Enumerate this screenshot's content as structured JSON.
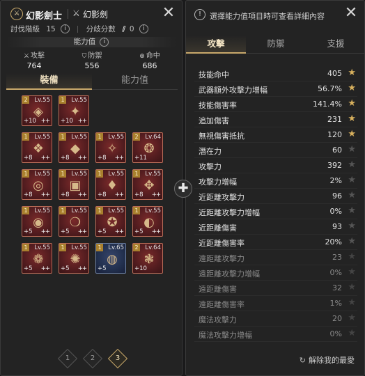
{
  "character": {
    "class_name": "幻影劍士",
    "weapon_name": "幻影劍",
    "conquest_label": "討伐階級",
    "conquest_value": "15",
    "branch_label": "分歧分數",
    "branch_value": "0"
  },
  "ability_value_label": "能力值",
  "core_stats": [
    {
      "label": "攻擊",
      "value": "764",
      "icon": "crossed-swords-icon"
    },
    {
      "label": "防禦",
      "value": "556",
      "icon": "shield-icon"
    },
    {
      "label": "命中",
      "value": "686",
      "icon": "target-icon"
    }
  ],
  "left_tabs": [
    "裝備",
    "能力值"
  ],
  "equipment": [
    {
      "tier": "2",
      "level": "Lv.55",
      "enhance": "+10",
      "pp": "++",
      "color": "red"
    },
    {
      "tier": "1",
      "level": "Lv.55",
      "enhance": "+10",
      "pp": "++",
      "color": "red"
    },
    {
      "tier": "1",
      "level": "Lv.55",
      "enhance": "+8",
      "pp": "++",
      "color": "red"
    },
    {
      "tier": "1",
      "level": "Lv.55",
      "enhance": "+8",
      "pp": "++",
      "color": "red"
    },
    {
      "tier": "1",
      "level": "Lv.55",
      "enhance": "+8",
      "pp": "++",
      "color": "red"
    },
    {
      "tier": "2",
      "level": "Lv.64",
      "enhance": "+11",
      "pp": "",
      "color": "red"
    },
    {
      "tier": "1",
      "level": "Lv.55",
      "enhance": "+8",
      "pp": "++",
      "color": "red"
    },
    {
      "tier": "1",
      "level": "Lv.55",
      "enhance": "+8",
      "pp": "++",
      "color": "red"
    },
    {
      "tier": "1",
      "level": "Lv.55",
      "enhance": "+8",
      "pp": "++",
      "color": "red"
    },
    {
      "tier": "1",
      "level": "Lv.55",
      "enhance": "+8",
      "pp": "++",
      "color": "red"
    },
    {
      "tier": "1",
      "level": "Lv.55",
      "enhance": "+5",
      "pp": "++",
      "color": "red"
    },
    {
      "tier": "1",
      "level": "Lv.55",
      "enhance": "+5",
      "pp": "++",
      "color": "red"
    },
    {
      "tier": "1",
      "level": "Lv.55",
      "enhance": "+5",
      "pp": "++",
      "color": "red"
    },
    {
      "tier": "1",
      "level": "Lv.55",
      "enhance": "+5",
      "pp": "++",
      "color": "red"
    },
    {
      "tier": "1",
      "level": "Lv.55",
      "enhance": "+5",
      "pp": "++",
      "color": "red"
    },
    {
      "tier": "1",
      "level": "Lv.55",
      "enhance": "+5",
      "pp": "++",
      "color": "red"
    },
    {
      "tier": "1",
      "level": "Lv.65",
      "enhance": "+5",
      "pp": "",
      "color": "blue"
    },
    {
      "tier": "2",
      "level": "Lv.64",
      "enhance": "+10",
      "pp": "",
      "color": "red"
    }
  ],
  "pages": [
    "1",
    "2",
    "3"
  ],
  "active_page": "3",
  "info_text": "選擇能力值項目時可查看詳細內容",
  "right_tabs": [
    "攻擊",
    "防禦",
    "支援"
  ],
  "stats": [
    {
      "name": "技能命中",
      "value": "405",
      "fav": true,
      "dim": false
    },
    {
      "name": "武器額外攻擊力增幅",
      "value": "56.7%",
      "fav": true,
      "dim": false
    },
    {
      "name": "技能傷害率",
      "value": "141.4%",
      "fav": true,
      "dim": false
    },
    {
      "name": "追加傷害",
      "value": "231",
      "fav": true,
      "dim": false
    },
    {
      "name": "無視傷害抵抗",
      "value": "120",
      "fav": true,
      "dim": false
    },
    {
      "name": "潛在力",
      "value": "60",
      "fav": false,
      "dim": false
    },
    {
      "name": "攻擊力",
      "value": "392",
      "fav": false,
      "dim": false
    },
    {
      "name": "攻擊力增幅",
      "value": "2%",
      "fav": false,
      "dim": false
    },
    {
      "name": "近距離攻擊力",
      "value": "96",
      "fav": false,
      "dim": false
    },
    {
      "name": "近距離攻擊力增幅",
      "value": "0%",
      "fav": false,
      "dim": false
    },
    {
      "name": "近距離傷害",
      "value": "93",
      "fav": false,
      "dim": false
    },
    {
      "name": "近距離傷害率",
      "value": "20%",
      "fav": false,
      "dim": false
    },
    {
      "name": "遠距離攻擊力",
      "value": "23",
      "fav": false,
      "dim": true
    },
    {
      "name": "遠距離攻擊力增幅",
      "value": "0%",
      "fav": false,
      "dim": true
    },
    {
      "name": "遠距離傷害",
      "value": "32",
      "fav": false,
      "dim": true
    },
    {
      "name": "遠距離傷害率",
      "value": "1%",
      "fav": false,
      "dim": true
    },
    {
      "name": "魔法攻擊力",
      "value": "20",
      "fav": false,
      "dim": true
    },
    {
      "name": "魔法攻擊力增幅",
      "value": "0%",
      "fav": false,
      "dim": true
    }
  ],
  "clear_fav_label": "解除我的最愛",
  "colors": {
    "accent_gold": "#c9a96b",
    "star_gold": "#d8b15e",
    "slot_red": "#b86b57",
    "slot_blue": "#6a7ea0"
  }
}
